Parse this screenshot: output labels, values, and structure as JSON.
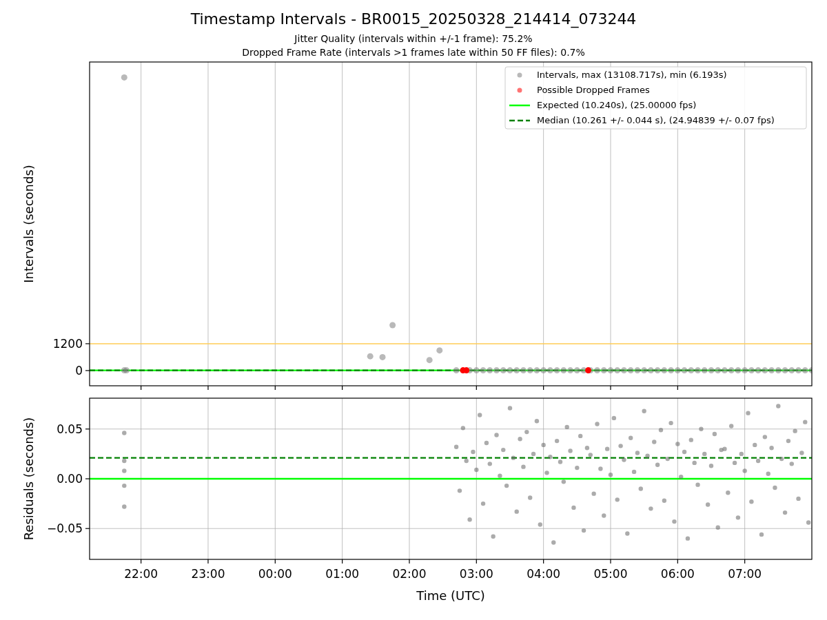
{
  "figure": {
    "title": "Timestamp Intervals - BR0015_20250328_214414_073244",
    "subtitles": [
      "Jitter Quality (intervals within +/-1 frame): 75.2%",
      "Dropped Frame Rate (intervals >1 frames late within 50 FF files): 0.7%"
    ]
  },
  "top_panel": {
    "chart_data": {
      "type": "scatter",
      "ylabel": "Intervals (seconds)",
      "grid": "x",
      "legend": true,
      "xlim": [
        "2025-03-28T21:14",
        "2025-03-29T08:00"
      ],
      "ylim": [
        -680,
        13790
      ],
      "yticks": [
        {
          "value": 0,
          "label": "0"
        },
        {
          "value": 1200,
          "label": "1200"
        }
      ],
      "series": [
        {
          "name": "Intervals, max (13108.717s), min (6.193s)",
          "type": "scatter",
          "color": "#808080",
          "x": [
            "2025-03-28T21:45",
            "2025-03-28T21:45",
            "2025-03-28T21:47",
            "2025-03-29T01:25",
            "2025-03-29T01:36",
            "2025-03-29T01:45",
            "2025-03-29T02:18",
            "2025-03-29T02:27",
            "2025-03-29T02:42",
            "2025-03-29T02:54",
            "2025-03-29T03:00",
            "2025-03-29T03:06",
            "2025-03-29T03:12",
            "2025-03-29T03:18",
            "2025-03-29T03:24",
            "2025-03-29T03:30",
            "2025-03-29T03:36",
            "2025-03-29T03:42",
            "2025-03-29T03:48",
            "2025-03-29T03:54",
            "2025-03-29T04:00",
            "2025-03-29T04:06",
            "2025-03-29T04:12",
            "2025-03-29T04:18",
            "2025-03-29T04:24",
            "2025-03-29T04:30",
            "2025-03-29T04:36",
            "2025-03-29T04:42",
            "2025-03-29T04:48",
            "2025-03-29T04:54",
            "2025-03-29T05:00",
            "2025-03-29T05:06",
            "2025-03-29T05:12",
            "2025-03-29T05:18",
            "2025-03-29T05:24",
            "2025-03-29T05:30",
            "2025-03-29T05:36",
            "2025-03-29T05:42",
            "2025-03-29T05:48",
            "2025-03-29T05:54",
            "2025-03-29T06:00",
            "2025-03-29T06:06",
            "2025-03-29T06:12",
            "2025-03-29T06:18",
            "2025-03-29T06:24",
            "2025-03-29T06:30",
            "2025-03-29T06:36",
            "2025-03-29T06:42",
            "2025-03-29T06:48",
            "2025-03-29T06:54",
            "2025-03-29T07:00",
            "2025-03-29T07:06",
            "2025-03-29T07:12",
            "2025-03-29T07:18",
            "2025-03-29T07:24",
            "2025-03-29T07:30",
            "2025-03-29T07:36",
            "2025-03-29T07:42",
            "2025-03-29T07:48",
            "2025-03-29T07:54",
            "2025-03-29T08:00"
          ],
          "values": [
            13100,
            10,
            10,
            640,
            600,
            2030,
            470,
            900,
            10,
            10,
            10,
            10,
            10,
            10,
            10,
            10,
            10,
            10,
            10,
            10,
            10,
            10,
            10,
            10,
            10,
            10,
            10,
            10,
            10,
            10,
            10,
            10,
            10,
            10,
            10,
            10,
            10,
            10,
            10,
            10,
            10,
            10,
            10,
            10,
            10,
            10,
            10,
            10,
            10,
            10,
            10,
            10,
            10,
            10,
            10,
            10,
            10,
            10,
            10,
            10,
            10
          ]
        },
        {
          "name": "Possible Dropped Frames",
          "type": "scatter",
          "color": "#ff0000",
          "x": [
            "2025-03-29T02:48",
            "2025-03-29T02:51",
            "2025-03-29T04:40"
          ],
          "values": [
            10,
            10,
            10
          ]
        },
        {
          "name": "Expected (10.240s), (25.00000 fps)",
          "type": "line",
          "line_style": "solid",
          "color": "#00ff00",
          "x": [
            "2025-03-28T21:14",
            "2025-03-29T08:00"
          ],
          "values": [
            10,
            10
          ]
        },
        {
          "name": "Median (10.261 +/- 0.044 s), (24.94839 +/- 0.07 fps)",
          "type": "line",
          "line_style": "dashed",
          "color": "#008000",
          "x": [
            "2025-03-28T21:14",
            "2025-03-29T08:00"
          ],
          "values": [
            10,
            10
          ]
        },
        {
          "type": "line",
          "line_style": "solid",
          "color": "#ffcc55",
          "x": [
            "2025-03-28T21:14",
            "2025-03-29T08:00"
          ],
          "values": [
            1200,
            1200
          ]
        }
      ]
    }
  },
  "bottom_panel": {
    "chart_data": {
      "type": "scatter",
      "xlabel": "Time (UTC)",
      "ylabel": "Residuals (seconds)",
      "grid": "both",
      "xlim": [
        "2025-03-28T21:14",
        "2025-03-29T08:00"
      ],
      "ylim": [
        -0.081,
        0.081
      ],
      "xticks": [
        {
          "value": "2025-03-28T22:00",
          "label": "22:00"
        },
        {
          "value": "2025-03-28T23:00",
          "label": "23:00"
        },
        {
          "value": "2025-03-29T00:00",
          "label": "00:00"
        },
        {
          "value": "2025-03-29T01:00",
          "label": "01:00"
        },
        {
          "value": "2025-03-29T02:00",
          "label": "02:00"
        },
        {
          "value": "2025-03-29T03:00",
          "label": "03:00"
        },
        {
          "value": "2025-03-29T04:00",
          "label": "04:00"
        },
        {
          "value": "2025-03-29T05:00",
          "label": "05:00"
        },
        {
          "value": "2025-03-29T06:00",
          "label": "06:00"
        },
        {
          "value": "2025-03-29T07:00",
          "label": "07:00"
        }
      ],
      "yticks": [
        {
          "value": -0.05,
          "label": "−0.05"
        },
        {
          "value": 0,
          "label": "0.00"
        },
        {
          "value": 0.05,
          "label": "0.05"
        }
      ],
      "series": [
        {
          "type": "scatter",
          "color": "#666666",
          "x": [
            "2025-03-28T21:45",
            "2025-03-28T21:45",
            "2025-03-28T21:45",
            "2025-03-28T21:45",
            "2025-03-28T21:45",
            "2025-03-29T02:42",
            "2025-03-29T02:45",
            "2025-03-29T02:48",
            "2025-03-29T02:51",
            "2025-03-29T02:54",
            "2025-03-29T02:57",
            "2025-03-29T03:00",
            "2025-03-29T03:03",
            "2025-03-29T03:06",
            "2025-03-29T03:09",
            "2025-03-29T03:12",
            "2025-03-29T03:15",
            "2025-03-29T03:18",
            "2025-03-29T03:21",
            "2025-03-29T03:24",
            "2025-03-29T03:27",
            "2025-03-29T03:30",
            "2025-03-29T03:33",
            "2025-03-29T03:36",
            "2025-03-29T03:39",
            "2025-03-29T03:42",
            "2025-03-29T03:45",
            "2025-03-29T03:48",
            "2025-03-29T03:51",
            "2025-03-29T03:54",
            "2025-03-29T03:57",
            "2025-03-29T04:00",
            "2025-03-29T04:03",
            "2025-03-29T04:06",
            "2025-03-29T04:09",
            "2025-03-29T04:12",
            "2025-03-29T04:15",
            "2025-03-29T04:18",
            "2025-03-29T04:21",
            "2025-03-29T04:24",
            "2025-03-29T04:27",
            "2025-03-29T04:30",
            "2025-03-29T04:33",
            "2025-03-29T04:36",
            "2025-03-29T04:39",
            "2025-03-29T04:42",
            "2025-03-29T04:45",
            "2025-03-29T04:48",
            "2025-03-29T04:51",
            "2025-03-29T04:54",
            "2025-03-29T04:57",
            "2025-03-29T05:00",
            "2025-03-29T05:03",
            "2025-03-29T05:06",
            "2025-03-29T05:09",
            "2025-03-29T05:12",
            "2025-03-29T05:15",
            "2025-03-29T05:18",
            "2025-03-29T05:21",
            "2025-03-29T05:24",
            "2025-03-29T05:27",
            "2025-03-29T05:30",
            "2025-03-29T05:33",
            "2025-03-29T05:36",
            "2025-03-29T05:39",
            "2025-03-29T05:42",
            "2025-03-29T05:45",
            "2025-03-29T05:48",
            "2025-03-29T05:51",
            "2025-03-29T05:54",
            "2025-03-29T05:57",
            "2025-03-29T06:00",
            "2025-03-29T06:03",
            "2025-03-29T06:06",
            "2025-03-29T06:09",
            "2025-03-29T06:12",
            "2025-03-29T06:15",
            "2025-03-29T06:18",
            "2025-03-29T06:21",
            "2025-03-29T06:24",
            "2025-03-29T06:27",
            "2025-03-29T06:30",
            "2025-03-29T06:33",
            "2025-03-29T06:36",
            "2025-03-29T06:39",
            "2025-03-29T06:42",
            "2025-03-29T06:45",
            "2025-03-29T06:48",
            "2025-03-29T06:51",
            "2025-03-29T06:54",
            "2025-03-29T06:57",
            "2025-03-29T07:00",
            "2025-03-29T07:03",
            "2025-03-29T07:06",
            "2025-03-29T07:09",
            "2025-03-29T07:12",
            "2025-03-29T07:15",
            "2025-03-29T07:18",
            "2025-03-29T07:21",
            "2025-03-29T07:24",
            "2025-03-29T07:27",
            "2025-03-29T07:30",
            "2025-03-29T07:33",
            "2025-03-29T07:36",
            "2025-03-29T07:39",
            "2025-03-29T07:42",
            "2025-03-29T07:45",
            "2025-03-29T07:48",
            "2025-03-29T07:51",
            "2025-03-29T07:54",
            "2025-03-29T07:57"
          ],
          "values": [
            0.046,
            0.018,
            0.008,
            -0.007,
            -0.028,
            0.032,
            -0.012,
            0.051,
            0.018,
            -0.041,
            0.027,
            0.009,
            0.064,
            -0.025,
            0.036,
            0.015,
            -0.058,
            0.044,
            0.003,
            0.029,
            -0.007,
            0.071,
            0.021,
            -0.033,
            0.04,
            0.012,
            0.047,
            -0.019,
            0.025,
            0.058,
            -0.046,
            0.034,
            0.006,
            0.022,
            -0.064,
            0.038,
            0.017,
            -0.003,
            0.052,
            0.028,
            -0.029,
            0.011,
            0.043,
            -0.052,
            0.031,
            0.024,
            -0.015,
            0.055,
            0.01,
            -0.037,
            0.03,
            0.004,
            0.061,
            -0.021,
            0.033,
            0.019,
            -0.055,
            0.041,
            0.007,
            0.026,
            -0.01,
            0.068,
            0.023,
            -0.03,
            0.037,
            0.014,
            0.049,
            -0.022,
            0.02,
            0.056,
            -0.043,
            0.035,
            0.002,
            0.027,
            -0.06,
            0.039,
            0.016,
            -0.006,
            0.05,
            0.025,
            -0.026,
            0.013,
            0.045,
            -0.049,
            0.029,
            0.03,
            -0.014,
            0.053,
            0.016,
            -0.039,
            0.025,
            0.008,
            0.066,
            -0.023,
            0.034,
            0.018,
            -0.056,
            0.042,
            0.005,
            0.031,
            -0.009,
            0.073,
            0.02,
            -0.034,
            0.038,
            0.015,
            0.048,
            -0.02,
            0.026,
            0.057,
            -0.044
          ]
        },
        {
          "type": "line",
          "line_style": "solid",
          "color": "#00ff00",
          "x": [
            "2025-03-28T21:14",
            "2025-03-29T08:00"
          ],
          "values": [
            0,
            0
          ]
        },
        {
          "type": "line",
          "line_style": "dashed",
          "color": "#008000",
          "x": [
            "2025-03-28T21:14",
            "2025-03-29T08:00"
          ],
          "values": [
            0.021,
            0.021
          ]
        }
      ]
    }
  }
}
